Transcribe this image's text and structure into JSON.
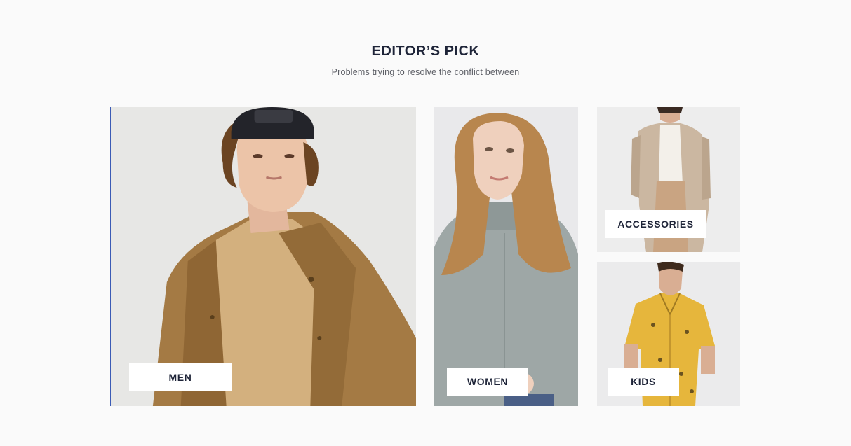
{
  "header": {
    "title": "EDITOR’S PICK",
    "subtitle": "Problems trying to resolve the conflict between"
  },
  "categories": [
    {
      "label": "MEN",
      "image": "man in tan hooded jacket and backwards black cap"
    },
    {
      "label": "WOMEN",
      "image": "woman in grey knit sweater"
    },
    {
      "label": "ACCESSORIES",
      "image": "woman in beige long cardigan"
    },
    {
      "label": "KIDS",
      "image": "man in yellow patterned short-sleeve shirt"
    }
  ],
  "colors": {
    "background": "#fafafa",
    "heading": "#1e2438",
    "subtitle": "#5d5f66",
    "label_background": "#ffffff"
  }
}
